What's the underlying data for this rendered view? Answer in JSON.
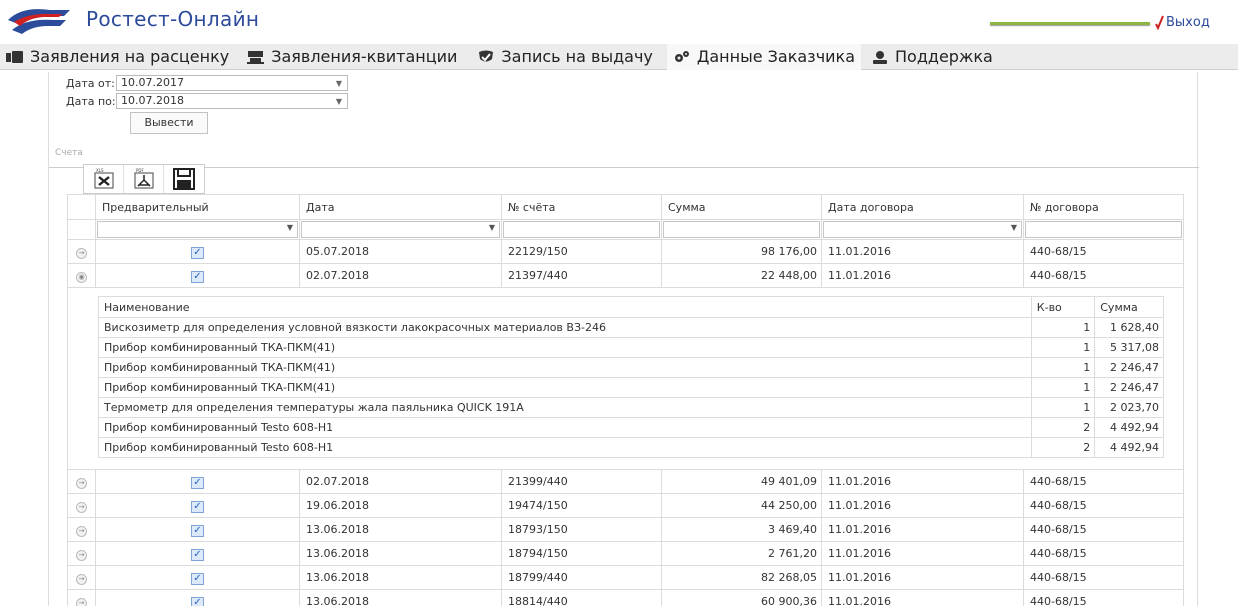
{
  "app": {
    "title": "Ростест-Онлайн",
    "exit_label": "Выход"
  },
  "nav": {
    "tabs": [
      {
        "label": "Заявления на расценку",
        "icon": "cards-icon"
      },
      {
        "label": "Заявления-квитанции",
        "icon": "cash-register-icon"
      },
      {
        "label": "Запись на выдачу",
        "icon": "check-shield-icon"
      },
      {
        "label": "Данные Заказчика",
        "icon": "gears-icon"
      },
      {
        "label": "Поддержка",
        "icon": "support-agent-icon"
      }
    ]
  },
  "filter": {
    "date_from_label": "Дата от:",
    "date_from_value": "10.07.2017",
    "date_to_label": "Дата по:",
    "date_to_value": "10.07.2018",
    "output_button": "Вывести"
  },
  "accounts": {
    "group_label": "Счета",
    "columns": [
      "Предварительный",
      "Дата",
      "№ счёта",
      "Сумма",
      "Дата договора",
      "№ договора"
    ],
    "rows_before": [
      {
        "date": "05.07.2018",
        "number": "22129/150",
        "sum": "98 176,00",
        "contract_date": "11.01.2016",
        "contract_no": "440-68/15"
      },
      {
        "date": "02.07.2018",
        "number": "21397/440",
        "sum": "22 448,00",
        "contract_date": "11.01.2016",
        "contract_no": "440-68/15"
      }
    ],
    "details": {
      "columns": [
        "Наименование",
        "К-во",
        "Сумма"
      ],
      "rows": [
        {
          "name": "Вискозиметр для определения условной вязкости лакокрасочных материалов ВЗ-246",
          "qty": "1",
          "sum": "1 628,40"
        },
        {
          "name": "Прибор комбинированный ТКА-ПКМ(41)",
          "qty": "1",
          "sum": "5 317,08"
        },
        {
          "name": "Прибор комбинированный ТКА-ПКМ(41)",
          "qty": "1",
          "sum": "2 246,47"
        },
        {
          "name": "Прибор комбинированный ТКА-ПКМ(41)",
          "qty": "1",
          "sum": "2 246,47"
        },
        {
          "name": "Термометр для определения температуры жала паяльника QUICK 191A",
          "qty": "1",
          "sum": "2 023,70"
        },
        {
          "name": "Прибор комбинированный Testo 608-H1",
          "qty": "2",
          "sum": "4 492,94"
        },
        {
          "name": "Прибор комбинированный Testo 608-H1",
          "qty": "2",
          "sum": "4 492,94"
        }
      ]
    },
    "rows_after": [
      {
        "date": "02.07.2018",
        "number": "21399/440",
        "sum": "49 401,09",
        "contract_date": "11.01.2016",
        "contract_no": "440-68/15"
      },
      {
        "date": "19.06.2018",
        "number": "19474/150",
        "sum": "44 250,00",
        "contract_date": "11.01.2016",
        "contract_no": "440-68/15"
      },
      {
        "date": "13.06.2018",
        "number": "18793/150",
        "sum": "3 469,40",
        "contract_date": "11.01.2016",
        "contract_no": "440-68/15"
      },
      {
        "date": "13.06.2018",
        "number": "18794/150",
        "sum": "2 761,20",
        "contract_date": "11.01.2016",
        "contract_no": "440-68/15"
      },
      {
        "date": "13.06.2018",
        "number": "18799/440",
        "sum": "82 268,05",
        "contract_date": "11.01.2016",
        "contract_no": "440-68/15"
      },
      {
        "date": "13.06.2018",
        "number": "18814/440",
        "sum": "60 900,36",
        "contract_date": "11.01.2016",
        "contract_no": "440-68/15"
      }
    ]
  },
  "colors": {
    "brand": "#2d4b9b",
    "accent_line": "#8db542",
    "exit_icon": "#d02020",
    "checkbox": "#2b64b8"
  }
}
